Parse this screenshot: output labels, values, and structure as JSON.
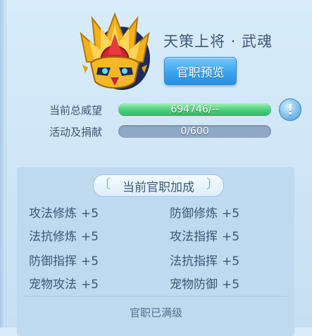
{
  "rank": {
    "title": "天策上将 · 武魂",
    "preview_button": "官职预览"
  },
  "stats": {
    "prestige_label": "当前总威望",
    "prestige_value": "694746/--",
    "prestige_fill_fraction": 1.0,
    "activity_label": "活动及捐献",
    "activity_value": "0/600",
    "activity_fill_fraction": 0.0
  },
  "bonus": {
    "header": "当前官职加成",
    "items": [
      {
        "name": "攻法修炼",
        "value": "+5"
      },
      {
        "name": "防御修炼",
        "value": "+5"
      },
      {
        "name": "法抗修炼",
        "value": "+5"
      },
      {
        "name": "攻法指挥",
        "value": "+5"
      },
      {
        "name": "防御指挥",
        "value": "+5"
      },
      {
        "name": "法抗指挥",
        "value": "+5"
      },
      {
        "name": "宠物攻法",
        "value": "+5"
      },
      {
        "name": "宠物防御",
        "value": "+5"
      }
    ],
    "status": "官职已满级"
  },
  "icons": {
    "help": "!"
  }
}
